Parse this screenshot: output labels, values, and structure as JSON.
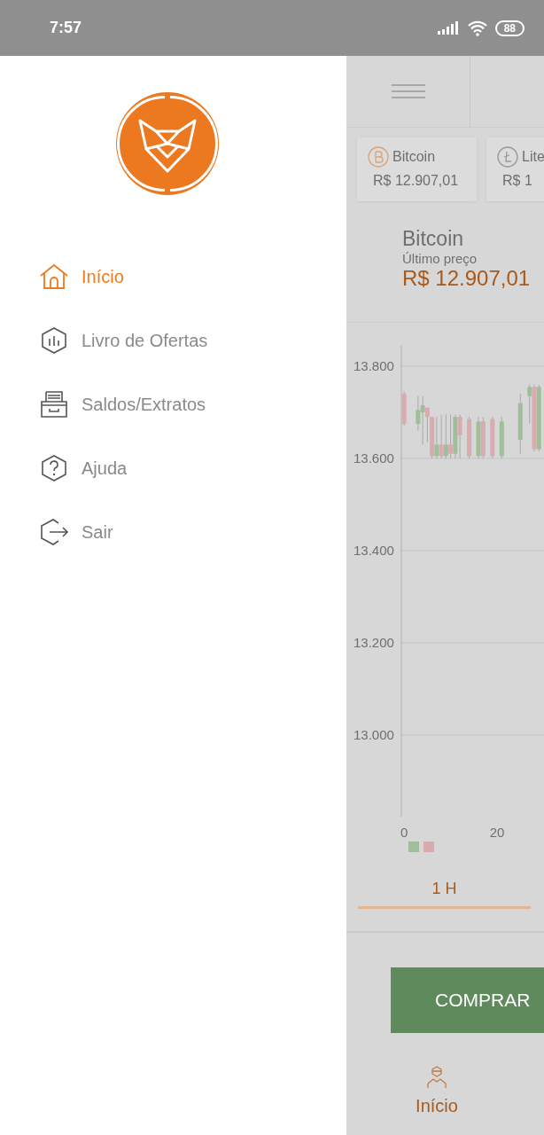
{
  "status_bar": {
    "time": "7:57",
    "battery": "88"
  },
  "drawer": {
    "items": [
      {
        "label": "Início",
        "kind": "home",
        "selected": true
      },
      {
        "label": "Livro de Ofertas",
        "kind": "book",
        "selected": false
      },
      {
        "label": "Saldos/Extratos",
        "kind": "tray",
        "selected": false
      },
      {
        "label": "Ajuda",
        "kind": "help",
        "selected": false
      },
      {
        "label": "Sair",
        "kind": "exit",
        "selected": false
      }
    ]
  },
  "background_app": {
    "coins": [
      {
        "name": "Bitcoin",
        "price": "R$ 12.907,01",
        "kind": "bitcoin"
      },
      {
        "name": "Lite",
        "price": "R$ 1",
        "kind": "litecoin"
      }
    ],
    "current_coin": {
      "name": "Bitcoin",
      "price_label": "Último preço",
      "price": "R$ 12.907,01"
    },
    "chart_data": {
      "type": "candlestick",
      "grid": true,
      "x": [
        0,
        3,
        4,
        5,
        6,
        7,
        8,
        9,
        10,
        11,
        12,
        14,
        16,
        17,
        19,
        21,
        25,
        27,
        28,
        29
      ],
      "ohlc": [
        [
          13740,
          13745,
          13670,
          13675
        ],
        [
          13675,
          13735,
          13660,
          13705
        ],
        [
          13700,
          13735,
          13630,
          13715
        ],
        [
          13710,
          13710,
          13635,
          13690
        ],
        [
          13690,
          13690,
          13600,
          13605
        ],
        [
          13605,
          13690,
          13600,
          13630
        ],
        [
          13630,
          13695,
          13600,
          13605
        ],
        [
          13605,
          13695,
          13600,
          13630
        ],
        [
          13630,
          13695,
          13600,
          13610
        ],
        [
          13610,
          13695,
          13600,
          13690
        ],
        [
          13690,
          13695,
          13600,
          13650
        ],
        [
          13685,
          13690,
          13600,
          13605
        ],
        [
          13605,
          13690,
          13600,
          13680
        ],
        [
          13680,
          13690,
          13600,
          13605
        ],
        [
          13685,
          13690,
          13600,
          13605
        ],
        [
          13605,
          13690,
          13600,
          13680
        ],
        [
          13640,
          13740,
          13610,
          13720
        ],
        [
          13735,
          13760,
          13675,
          13755
        ],
        [
          13755,
          13760,
          13615,
          13620
        ],
        [
          13620,
          13760,
          13615,
          13755
        ]
      ],
      "xlim": [
        -0.6,
        30.1
      ],
      "ylim": [
        12823,
        13846
      ],
      "xticks": [
        0,
        20
      ],
      "yticks": [
        {
          "value": 13000,
          "label": "13.000"
        },
        {
          "value": 13200,
          "label": "13.200"
        },
        {
          "value": 13400,
          "label": "13.400"
        },
        {
          "value": 13600,
          "label": "13.600"
        },
        {
          "value": 13800,
          "label": "13.800"
        }
      ]
    },
    "period_tabs": [
      {
        "label": "1 H",
        "selected": true
      }
    ],
    "buy_button": "COMPRAR",
    "bottom_nav": [
      {
        "label": "Início",
        "selected": true
      }
    ]
  }
}
